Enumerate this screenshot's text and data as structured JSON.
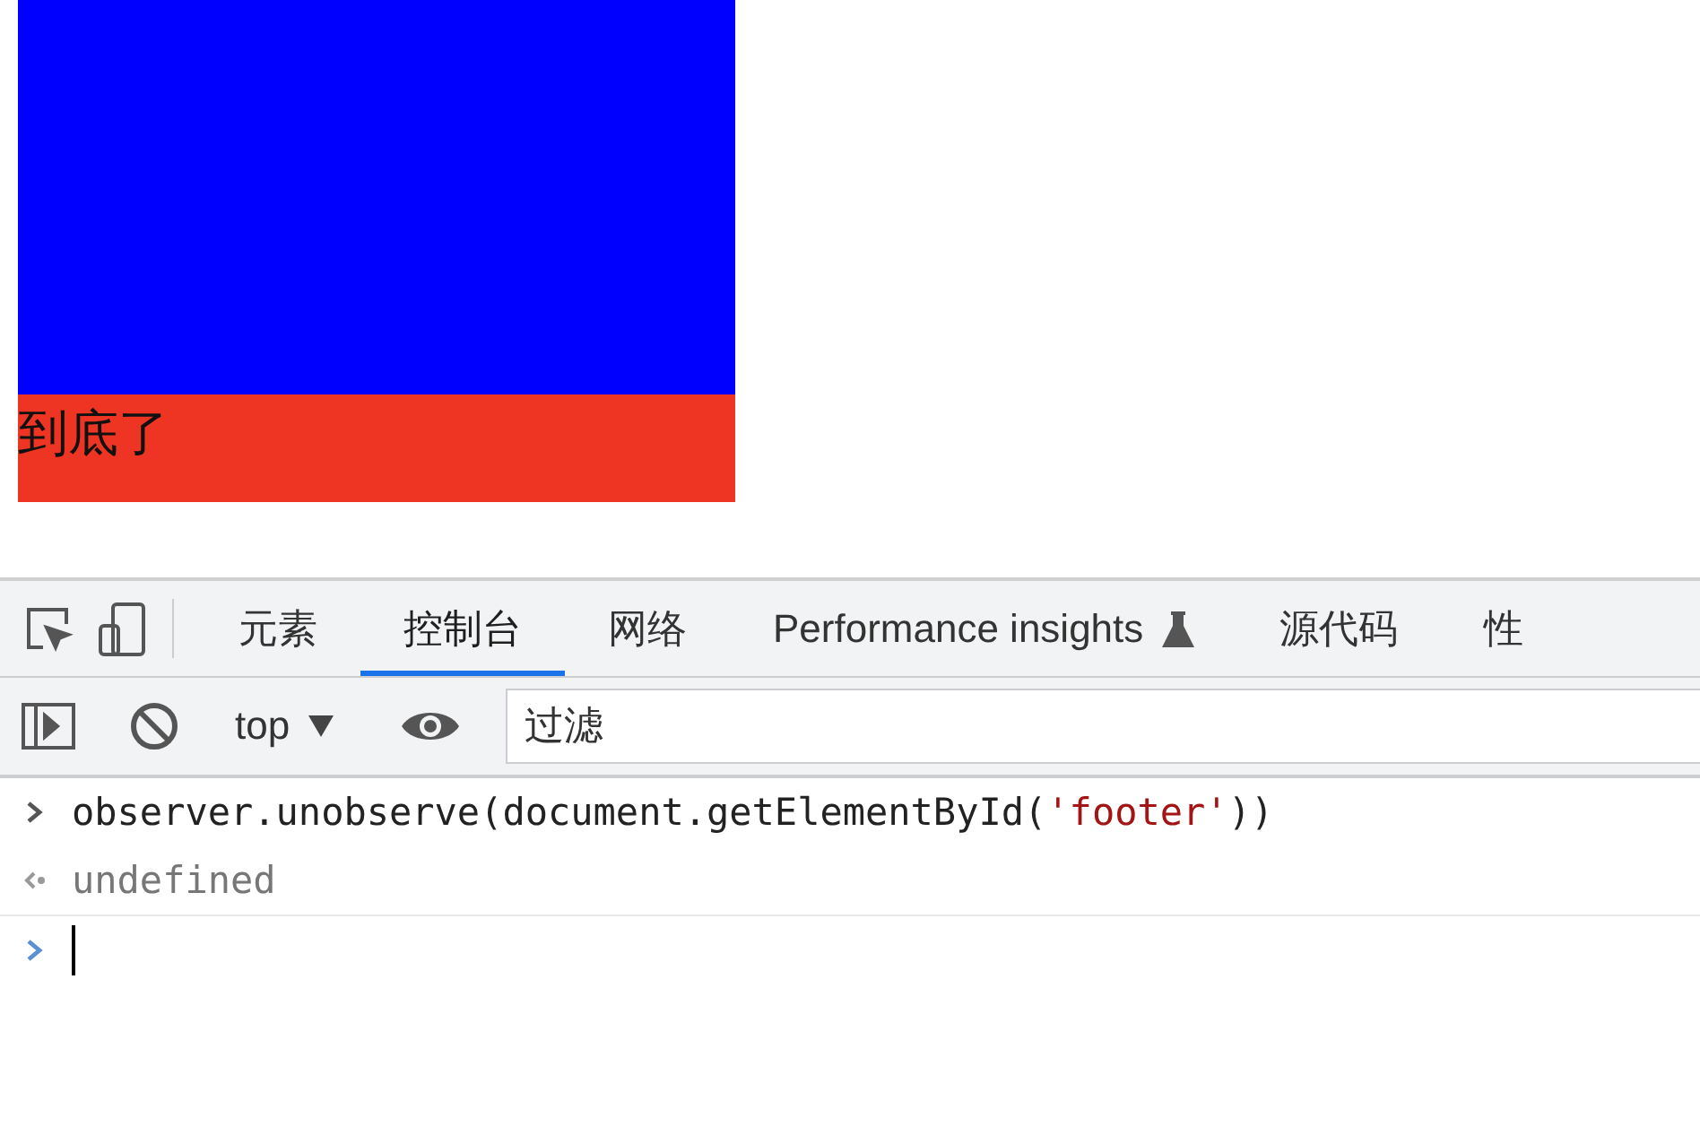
{
  "page": {
    "blocks": [
      {
        "kind": "blue"
      },
      {
        "kind": "footer",
        "text": "到底了"
      }
    ]
  },
  "devtools": {
    "tabs": [
      {
        "label": "元素",
        "selected": false,
        "flask": false
      },
      {
        "label": "控制台",
        "selected": true,
        "flask": false
      },
      {
        "label": "网络",
        "selected": false,
        "flask": false
      },
      {
        "label": "Performance insights",
        "selected": false,
        "flask": true
      },
      {
        "label": "源代码",
        "selected": false,
        "flask": false
      },
      {
        "label": "性",
        "selected": false,
        "flask": false
      }
    ],
    "toolbar": {
      "context": "top",
      "filter": {
        "placeholder": "过滤"
      }
    },
    "console": [
      {
        "kind": "input",
        "parts": [
          {
            "kind": "code",
            "text": "observer.unobserve(document.getElementById("
          },
          {
            "kind": "string",
            "text": "'footer'"
          },
          {
            "kind": "code",
            "text": "))"
          }
        ]
      },
      {
        "kind": "result",
        "parts": [
          {
            "kind": "code",
            "text": "undefined"
          }
        ]
      },
      {
        "kind": "prompt"
      }
    ]
  }
}
